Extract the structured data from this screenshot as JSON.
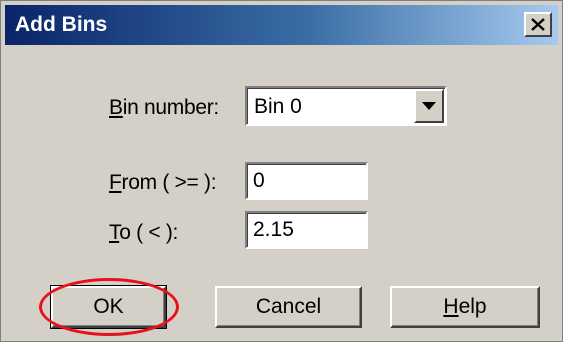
{
  "window": {
    "title": "Add Bins"
  },
  "fields": {
    "bin_number": {
      "label_accel": "B",
      "label_rest": "in number:",
      "value": "Bin 0"
    },
    "from": {
      "label_accel": "F",
      "label_rest": "rom ( >= ):",
      "value": "0"
    },
    "to": {
      "label_accel": "T",
      "label_rest": "o ( < ):",
      "value": "2.15"
    }
  },
  "buttons": {
    "ok": "OK",
    "cancel": "Cancel",
    "help_accel": "H",
    "help_rest": "elp"
  },
  "icons": {
    "close": "close-icon",
    "dropdown": "dropdown-arrow-icon"
  },
  "colors": {
    "titlebar_start": "#0a246a",
    "titlebar_end": "#a6caf0",
    "dialog_bg": "#d4d0c8",
    "highlight": "#e8111b"
  }
}
